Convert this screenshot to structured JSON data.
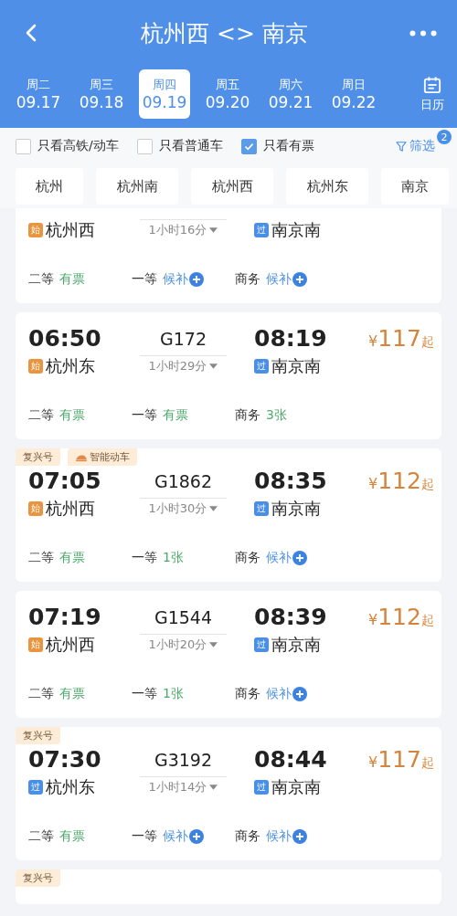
{
  "header": {
    "title": "杭州西 <> 南京"
  },
  "dates": [
    {
      "weekday": "周二",
      "date": "09.17",
      "selected": false
    },
    {
      "weekday": "周三",
      "date": "09.18",
      "selected": false
    },
    {
      "weekday": "周四",
      "date": "09.19",
      "selected": true
    },
    {
      "weekday": "周五",
      "date": "09.20",
      "selected": false
    },
    {
      "weekday": "周六",
      "date": "09.21",
      "selected": false
    },
    {
      "weekday": "周日",
      "date": "09.22",
      "selected": false
    }
  ],
  "calendar_button": {
    "label": "日历"
  },
  "filters": [
    {
      "label": "只看高铁/动车",
      "checked": false
    },
    {
      "label": "只看普通车",
      "checked": false
    },
    {
      "label": "只看有票",
      "checked": true
    }
  ],
  "filter_button": {
    "label": "筛选",
    "badge": "2"
  },
  "stations": [
    "杭州",
    "杭州南",
    "杭州西",
    "杭州东",
    "南京"
  ],
  "trains": [
    {
      "from": {
        "badge": "始",
        "kind": "start",
        "name": "杭州西"
      },
      "duration": "1小时16分",
      "to": {
        "badge": "过",
        "kind": "pass",
        "name": "南京南"
      },
      "seats": [
        {
          "class": "二等",
          "status": "有票",
          "kind": "available"
        },
        {
          "class": "一等",
          "status": "候补",
          "kind": "waitlist"
        },
        {
          "class": "商务",
          "status": "候补",
          "kind": "waitlist"
        }
      ]
    },
    {
      "depart": "06:50",
      "number": "G172",
      "arrive": "08:19",
      "price": {
        "currency": "¥",
        "amount": "117",
        "suffix": "起"
      },
      "from": {
        "badge": "始",
        "kind": "start",
        "name": "杭州东"
      },
      "duration": "1小时29分",
      "to": {
        "badge": "过",
        "kind": "pass",
        "name": "南京南"
      },
      "seats": [
        {
          "class": "二等",
          "status": "有票",
          "kind": "available"
        },
        {
          "class": "一等",
          "status": "有票",
          "kind": "available"
        },
        {
          "class": "商务",
          "status": "3张",
          "kind": "available"
        }
      ]
    },
    {
      "tags": [
        {
          "label": "复兴号",
          "kind": "plain"
        },
        {
          "label": "智能动车",
          "kind": "icon"
        }
      ],
      "depart": "07:05",
      "number": "G1862",
      "arrive": "08:35",
      "price": {
        "currency": "¥",
        "amount": "112",
        "suffix": "起"
      },
      "from": {
        "badge": "始",
        "kind": "start",
        "name": "杭州西"
      },
      "duration": "1小时30分",
      "to": {
        "badge": "过",
        "kind": "pass",
        "name": "南京南"
      },
      "seats": [
        {
          "class": "二等",
          "status": "有票",
          "kind": "available"
        },
        {
          "class": "一等",
          "status": "1张",
          "kind": "available"
        },
        {
          "class": "商务",
          "status": "候补",
          "kind": "waitlist"
        }
      ]
    },
    {
      "depart": "07:19",
      "number": "G1544",
      "arrive": "08:39",
      "price": {
        "currency": "¥",
        "amount": "112",
        "suffix": "起"
      },
      "from": {
        "badge": "始",
        "kind": "start",
        "name": "杭州西"
      },
      "duration": "1小时20分",
      "to": {
        "badge": "过",
        "kind": "pass",
        "name": "南京南"
      },
      "seats": [
        {
          "class": "二等",
          "status": "有票",
          "kind": "available"
        },
        {
          "class": "一等",
          "status": "1张",
          "kind": "available"
        },
        {
          "class": "商务",
          "status": "候补",
          "kind": "waitlist"
        }
      ]
    },
    {
      "tags": [
        {
          "label": "复兴号",
          "kind": "plain"
        }
      ],
      "depart": "07:30",
      "number": "G3192",
      "arrive": "08:44",
      "price": {
        "currency": "¥",
        "amount": "117",
        "suffix": "起"
      },
      "from": {
        "badge": "过",
        "kind": "pass",
        "name": "杭州东"
      },
      "duration": "1小时14分",
      "to": {
        "badge": "过",
        "kind": "pass",
        "name": "南京南"
      },
      "seats": [
        {
          "class": "二等",
          "status": "有票",
          "kind": "available"
        },
        {
          "class": "一等",
          "status": "候补",
          "kind": "waitlist"
        },
        {
          "class": "商务",
          "status": "候补",
          "kind": "waitlist"
        }
      ]
    },
    {
      "tags": [
        {
          "label": "复兴号",
          "kind": "plain"
        }
      ]
    }
  ]
}
